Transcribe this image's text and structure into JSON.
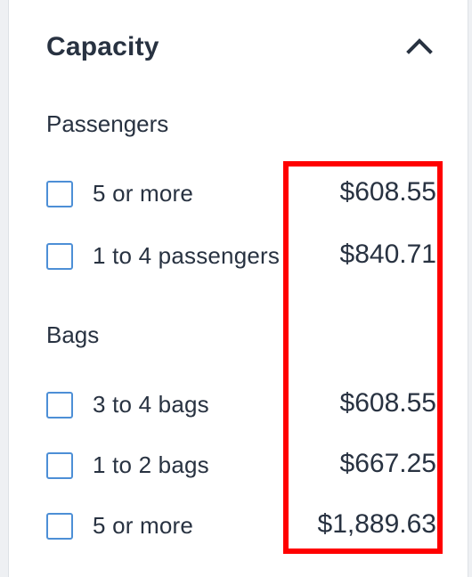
{
  "section": {
    "title": "Capacity",
    "toggle_icon": "chevron-up-icon"
  },
  "groups": [
    {
      "title": "Passengers",
      "options": [
        {
          "label": "5 or more",
          "price": "$608.55",
          "checked": false
        },
        {
          "label": "1 to 4 passengers",
          "price": "$840.71",
          "checked": false
        }
      ]
    },
    {
      "title": "Bags",
      "options": [
        {
          "label": "3 to 4 bags",
          "price": "$608.55",
          "checked": false
        },
        {
          "label": "1 to 2 bags",
          "price": "$667.25",
          "checked": false
        },
        {
          "label": "5 or more",
          "price": "$1,889.63",
          "checked": false
        }
      ]
    }
  ],
  "colors": {
    "text": "#283241",
    "checkbox_border": "#4d8fd6",
    "highlight": "#ff0000"
  }
}
